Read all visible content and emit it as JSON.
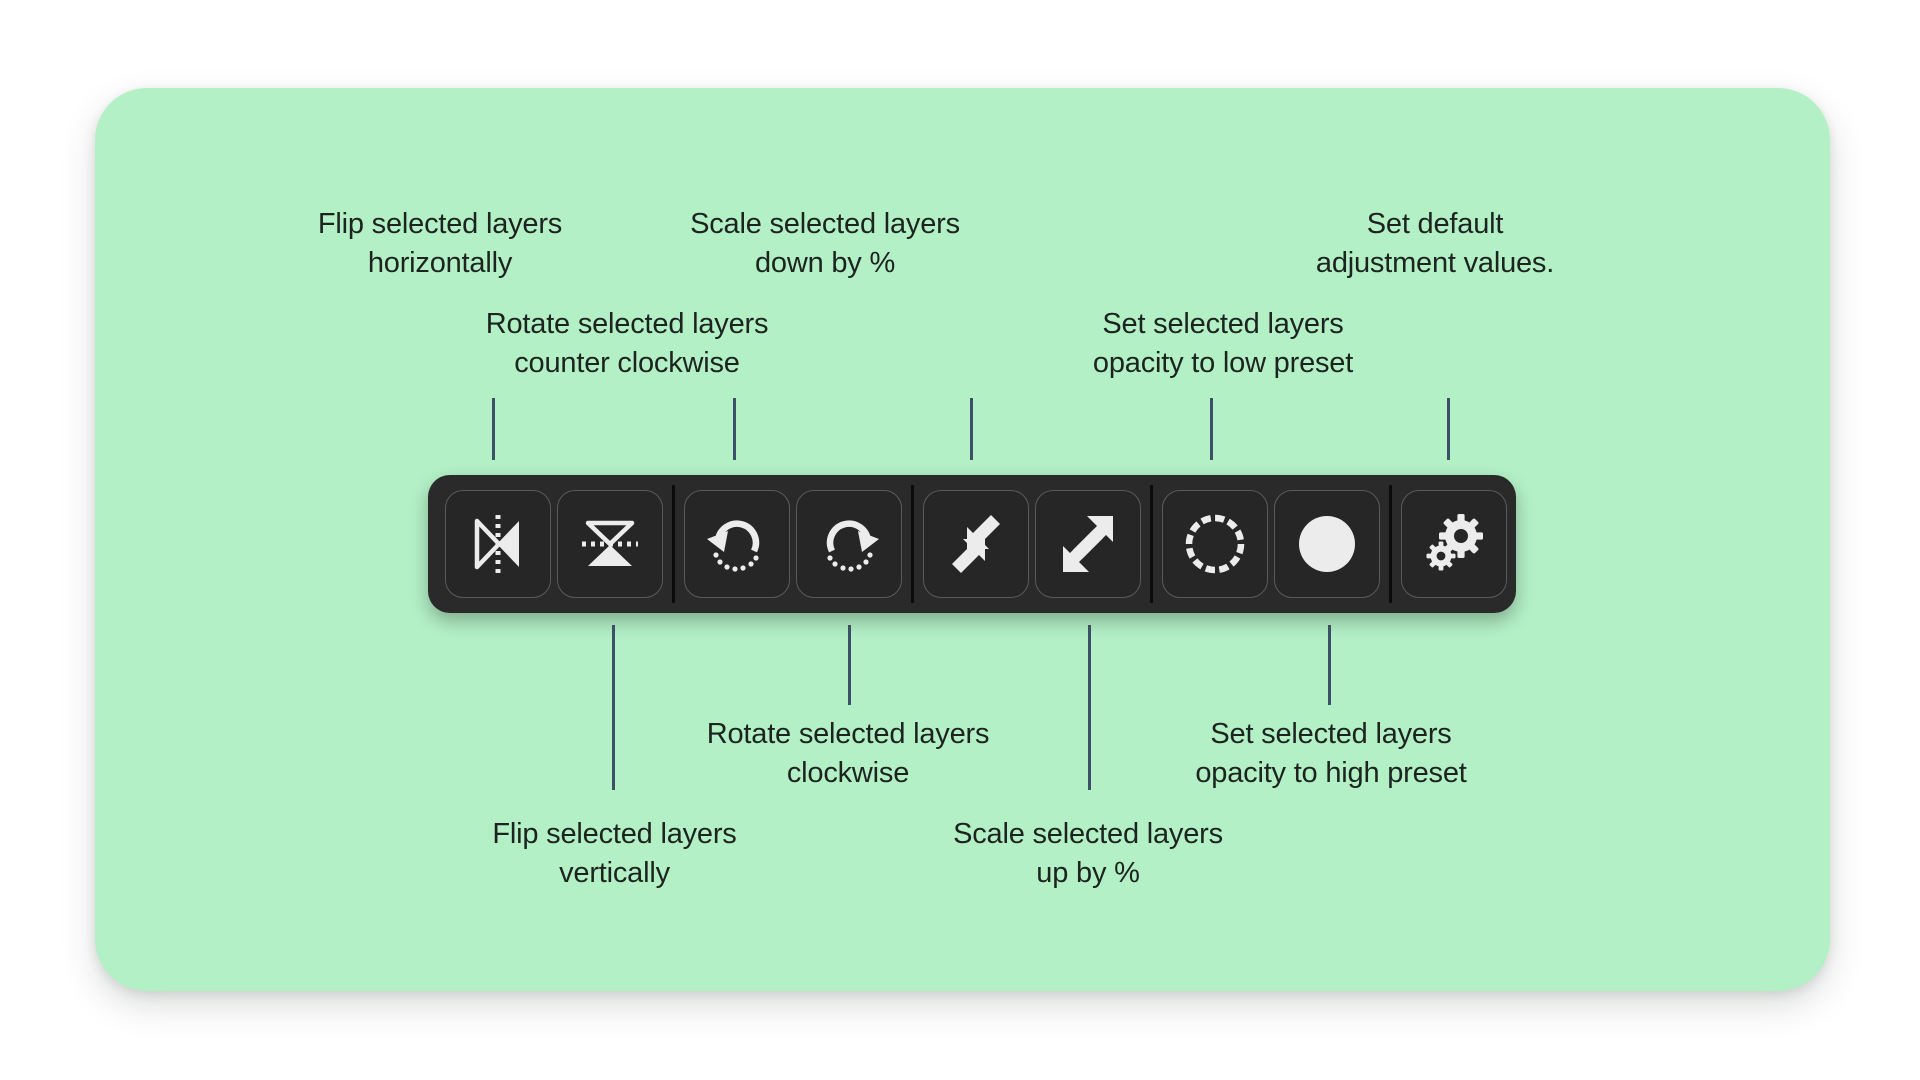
{
  "canvas": {
    "background_color": "#ffffff",
    "card_color": "#b3f0c6",
    "text_color": "#1d2420",
    "leader_line_color": "#3c5068",
    "toolbar_color": "#2a2a2a",
    "icon_color": "#ececec"
  },
  "toolbar": {
    "name": "transform-toolbar",
    "groups": [
      {
        "name": "flip-group",
        "buttons": [
          {
            "id": "flip-horizontal",
            "icon": "flip-horizontal-icon",
            "tooltip": "Flip selected layers horizontally"
          },
          {
            "id": "flip-vertical",
            "icon": "flip-vertical-icon",
            "tooltip": "Flip selected layers vertically"
          }
        ]
      },
      {
        "name": "rotate-group",
        "buttons": [
          {
            "id": "rotate-ccw",
            "icon": "rotate-counter-clockwise-icon",
            "tooltip": "Rotate selected layers counter clockwise"
          },
          {
            "id": "rotate-cw",
            "icon": "rotate-clockwise-icon",
            "tooltip": "Rotate selected layers clockwise"
          }
        ]
      },
      {
        "name": "scale-group",
        "buttons": [
          {
            "id": "scale-down",
            "icon": "scale-down-icon",
            "tooltip": "Scale selected layers down by %"
          },
          {
            "id": "scale-up",
            "icon": "scale-up-icon",
            "tooltip": "Scale selected layers up by %"
          }
        ]
      },
      {
        "name": "opacity-group",
        "buttons": [
          {
            "id": "opacity-low",
            "icon": "dashed-circle-icon",
            "tooltip": "Set selected layers opacity to low preset"
          },
          {
            "id": "opacity-high",
            "icon": "filled-circle-icon",
            "tooltip": "Set selected layers opacity to high preset"
          }
        ]
      },
      {
        "name": "settings-group",
        "buttons": [
          {
            "id": "default-adjustments",
            "icon": "gears-icon",
            "tooltip": "Set default adjustment values."
          }
        ]
      }
    ]
  },
  "annotations": {
    "above": [
      {
        "id": "annotation-flip-horizontal",
        "text": "Flip selected layers\nhorizontally"
      },
      {
        "id": "annotation-rotate-ccw",
        "text": "Rotate selected layers\ncounter clockwise"
      },
      {
        "id": "annotation-scale-down",
        "text": "Scale selected layers\ndown by %"
      },
      {
        "id": "annotation-opacity-low",
        "text": "Set selected layers\nopacity to low preset"
      },
      {
        "id": "annotation-default-adjustments",
        "text": "Set default\nadjustment values."
      }
    ],
    "below": [
      {
        "id": "annotation-flip-vertical",
        "text": "Flip selected layers\nvertically"
      },
      {
        "id": "annotation-rotate-cw",
        "text": "Rotate selected layers\nclockwise"
      },
      {
        "id": "annotation-scale-up",
        "text": "Scale selected layers\nup by %"
      },
      {
        "id": "annotation-opacity-high",
        "text": "Set selected layers\nopacity to high preset"
      }
    ]
  }
}
